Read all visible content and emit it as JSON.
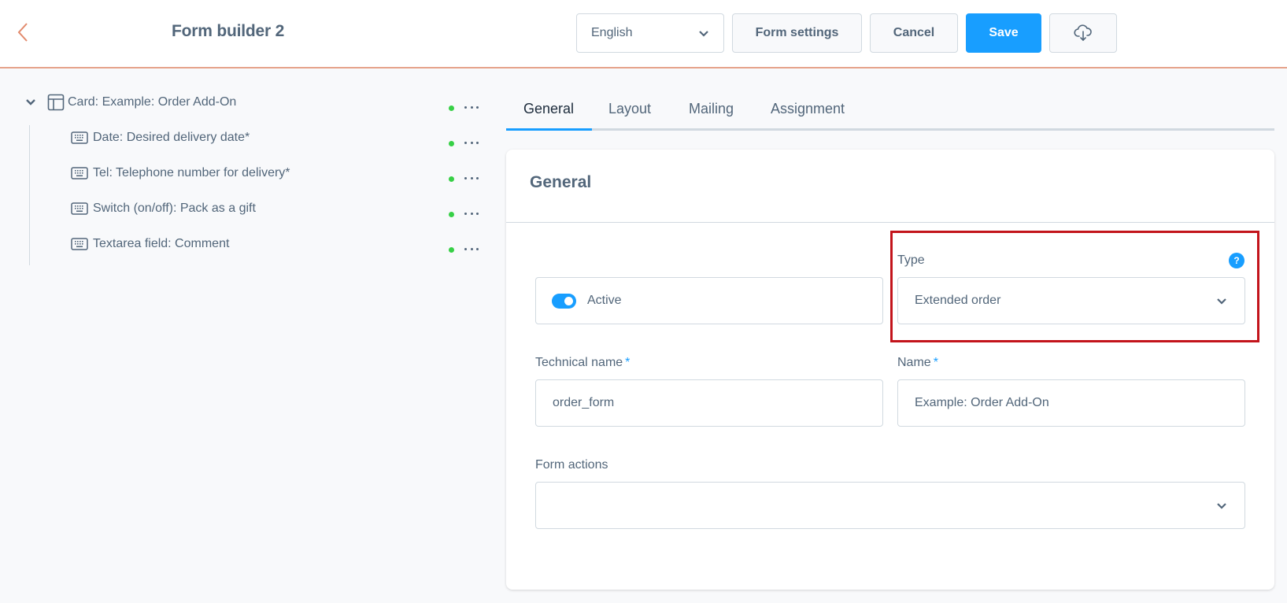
{
  "header": {
    "title": "Form builder 2",
    "back_icon": "chevron-left-icon",
    "language": "English",
    "form_settings_label": "Form settings",
    "cancel_label": "Cancel",
    "save_label": "Save",
    "download_icon": "cloud-download-icon"
  },
  "tree": {
    "root": {
      "label": "Card: Example: Order Add-On",
      "icon": "layout-icon",
      "expanded": true,
      "status": "active"
    },
    "children": [
      {
        "label": "Date: Desired delivery date*",
        "icon": "keyboard-icon",
        "status": "active"
      },
      {
        "label": "Tel: Telephone number for delivery*",
        "icon": "keyboard-icon",
        "status": "active"
      },
      {
        "label": "Switch (on/off): Pack as a gift",
        "icon": "keyboard-icon",
        "status": "active"
      },
      {
        "label": "Textarea field: Comment",
        "icon": "keyboard-icon",
        "status": "active"
      }
    ]
  },
  "tabs": [
    {
      "label": "General",
      "active": true
    },
    {
      "label": "Layout",
      "active": false
    },
    {
      "label": "Mailing",
      "active": false
    },
    {
      "label": "Assignment",
      "active": false
    }
  ],
  "general": {
    "title": "General",
    "active_label": "Active",
    "active_on": true,
    "type_label": "Type",
    "type_value": "Extended order",
    "technical_name_label": "Technical name",
    "technical_name_value": "order_form",
    "name_label": "Name",
    "name_value": "Example: Order Add-On",
    "required_mark": "*",
    "form_actions_label": "Form actions",
    "form_actions_value": "",
    "help_glyph": "?"
  },
  "colors": {
    "accent": "#189eff",
    "status_active": "#37d046",
    "highlight": "#c3141b",
    "header_border": "#e6a38a"
  }
}
